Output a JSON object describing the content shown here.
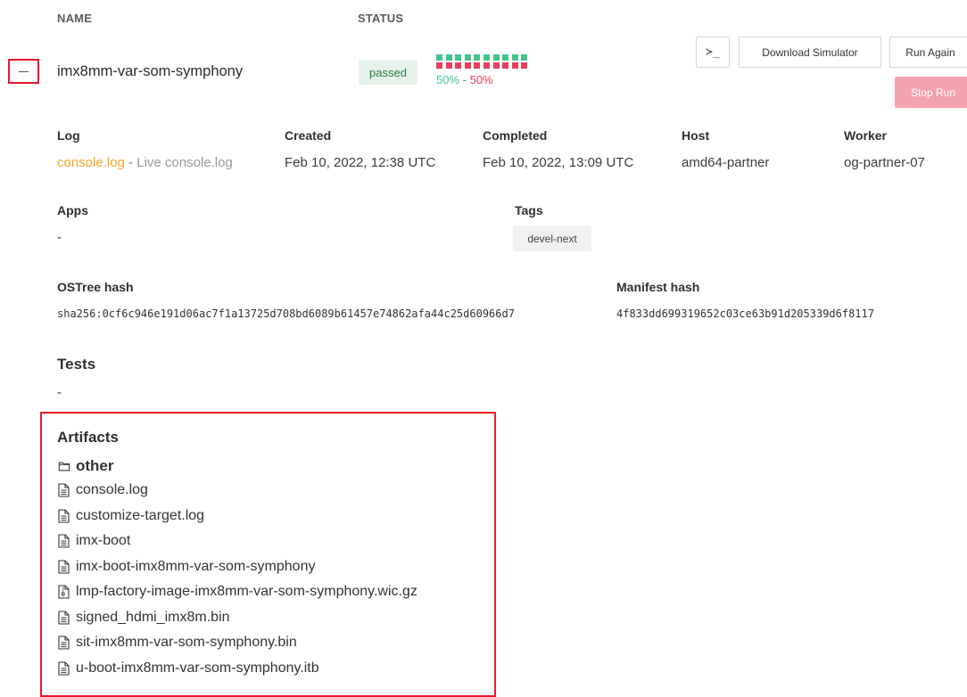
{
  "columns": {
    "name": "NAME",
    "status": "STATUS"
  },
  "run": {
    "name": "imx8mm-var-som-symphony",
    "status": "passed",
    "pass_percent": "50%",
    "separator": " - ",
    "fail_percent": "50%",
    "squares": [
      "pass",
      "fail",
      "pass",
      "fail",
      "pass",
      "fail",
      "pass",
      "fail",
      "pass",
      "fail",
      "pass",
      "fail",
      "pass",
      "fail",
      "pass",
      "fail",
      "pass",
      "fail",
      "pass",
      "fail"
    ]
  },
  "colors": {
    "pass": "#44c48c",
    "fail": "#e8405d",
    "accent_log": "#f5a623",
    "highlight_border": "#e8192c"
  },
  "actions": {
    "terminal_icon": "terminal-icon",
    "terminal_glyph": "≻_",
    "download_label": "Download Simulator",
    "run_again_label": "Run Again",
    "stop_label": "Stop Run"
  },
  "details": {
    "log_label": "Log",
    "log_primary": "console.log",
    "log_sep": " - ",
    "log_secondary": "Live console.log",
    "created_label": "Created",
    "created_value": "Feb 10, 2022, 12:38 UTC",
    "completed_label": "Completed",
    "completed_value": "Feb 10, 2022, 13:09 UTC",
    "host_label": "Host",
    "host_value": "amd64-partner",
    "worker_label": "Worker",
    "worker_value": "og-partner-07",
    "apps_label": "Apps",
    "apps_value": "-",
    "tags_label": "Tags",
    "tags": [
      "devel-next"
    ],
    "ostree_label": "OSTree hash",
    "ostree_value": "sha256:0cf6c946e191d06ac7f1a13725d708bd6089b61457e74862afa44c25d60966d7",
    "manifest_label": "Manifest hash",
    "manifest_value": "4f833dd699319652c03ce63b91d205339d6f8117"
  },
  "tests": {
    "title": "Tests",
    "value": "-"
  },
  "artifacts": {
    "title": "Artifacts",
    "folder": {
      "name": "other",
      "icon": "folder-icon"
    },
    "files": [
      {
        "name": "console.log",
        "icon": "file-text-icon"
      },
      {
        "name": "customize-target.log",
        "icon": "file-text-icon"
      },
      {
        "name": "imx-boot",
        "icon": "file-text-icon"
      },
      {
        "name": "imx-boot-imx8mm-var-som-symphony",
        "icon": "file-text-icon"
      },
      {
        "name": "lmp-factory-image-imx8mm-var-som-symphony.wic.gz",
        "icon": "file-zip-icon"
      },
      {
        "name": "signed_hdmi_imx8m.bin",
        "icon": "file-text-icon"
      },
      {
        "name": "sit-imx8mm-var-som-symphony.bin",
        "icon": "file-text-icon"
      },
      {
        "name": "u-boot-imx8mm-var-som-symphony.itb",
        "icon": "file-text-icon"
      }
    ]
  }
}
